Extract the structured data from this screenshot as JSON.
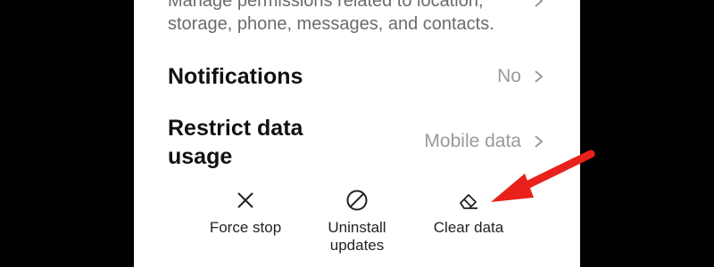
{
  "permissions": {
    "description": "Manage permissions related to location, storage, phone, messages, and contacts."
  },
  "notifications": {
    "label": "Notifications",
    "value": "No"
  },
  "restrict_data": {
    "label": "Restrict data usage",
    "value": "Mobile data"
  },
  "actions": {
    "force_stop": "Force stop",
    "uninstall_updates": "Uninstall updates",
    "clear_data": "Clear data"
  },
  "icons": {
    "force_stop": "close-x-icon",
    "uninstall_updates": "prohibit-icon",
    "clear_data": "eraser-icon",
    "chevron": "chevron-right-icon"
  },
  "colors": {
    "annotation_arrow": "#e8221b",
    "value_text": "#9a9a9a"
  }
}
